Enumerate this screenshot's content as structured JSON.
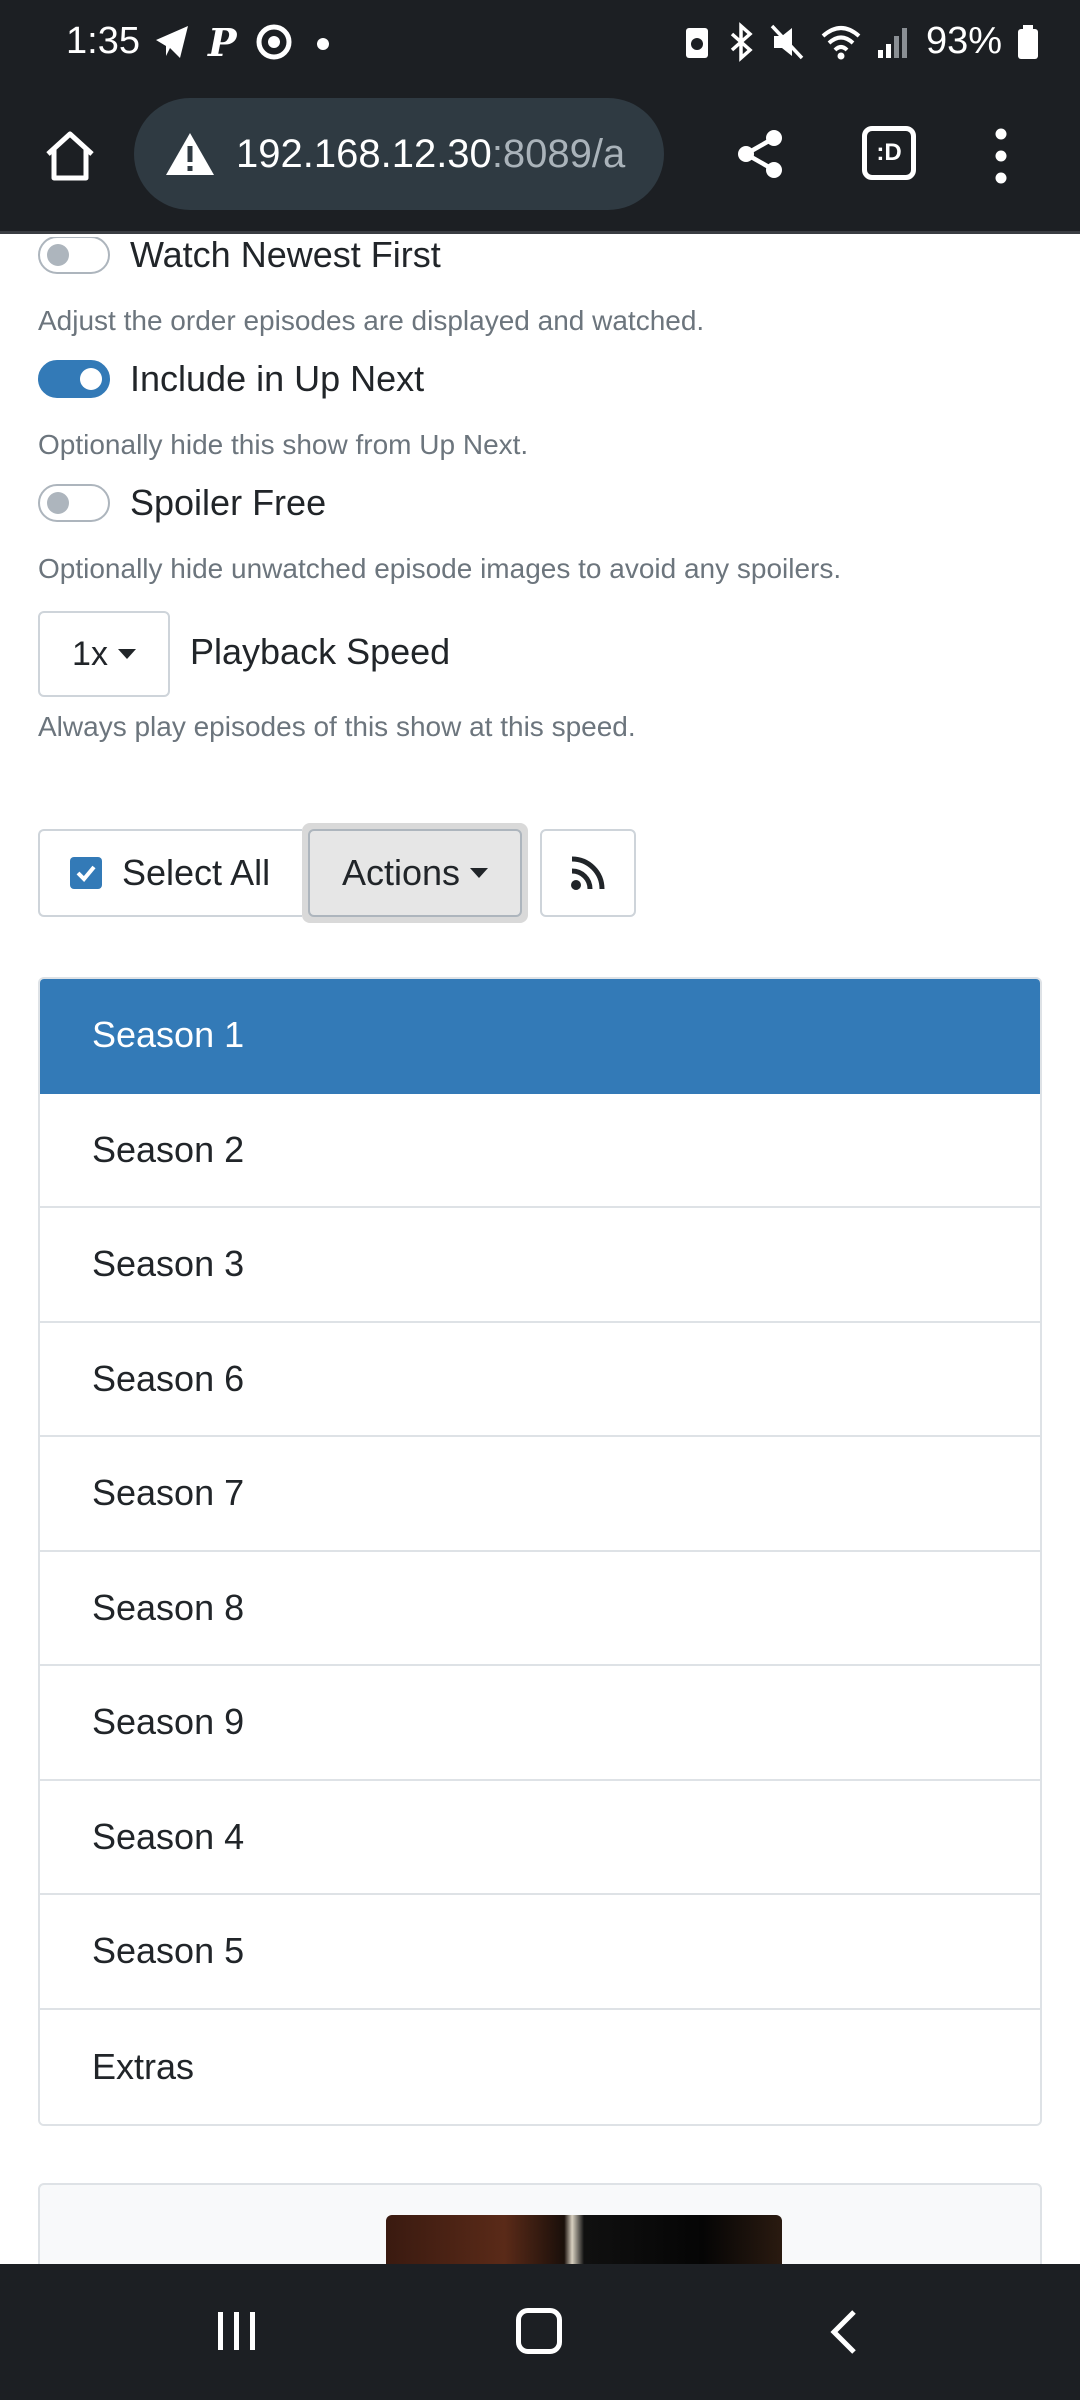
{
  "status_bar": {
    "time": "1:35",
    "battery_percent": "93%"
  },
  "browser": {
    "url_host": "192.168.12.30",
    "url_rest": ":8089/a",
    "tabs_label": ":D"
  },
  "settings": {
    "watch_newest_first": {
      "label": "Watch Newest First",
      "on": false,
      "help": "Adjust the order episodes are displayed and watched."
    },
    "include_up_next": {
      "label": "Include in Up Next",
      "on": true,
      "help": "Optionally hide this show from Up Next."
    },
    "spoiler_free": {
      "label": "Spoiler Free",
      "on": false,
      "help": "Optionally hide unwatched episode images to avoid any spoilers."
    },
    "playback_speed": {
      "value": "1x",
      "label": "Playback Speed",
      "help": "Always play episodes of this show at this speed."
    }
  },
  "toolbar": {
    "select_all_label": "Select All",
    "select_all_checked": true,
    "actions_label": "Actions"
  },
  "seasons": [
    {
      "label": "Season 1",
      "active": true
    },
    {
      "label": "Season 2",
      "active": false
    },
    {
      "label": "Season 3",
      "active": false
    },
    {
      "label": "Season 6",
      "active": false
    },
    {
      "label": "Season 7",
      "active": false
    },
    {
      "label": "Season 8",
      "active": false
    },
    {
      "label": "Season 9",
      "active": false
    },
    {
      "label": "Season 4",
      "active": false
    },
    {
      "label": "Season 5",
      "active": false
    },
    {
      "label": "Extras",
      "active": false
    }
  ],
  "colors": {
    "accent": "#337ab7",
    "chrome": "#1c1f23"
  }
}
